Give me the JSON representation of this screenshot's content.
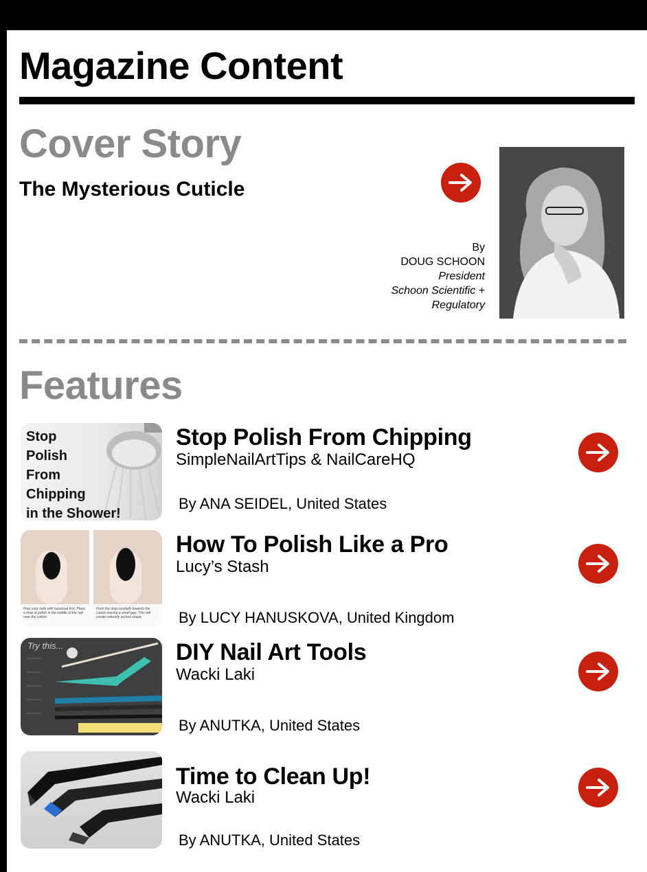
{
  "page": {
    "title": "Magazine Content"
  },
  "cover": {
    "heading": "Cover Story",
    "title": "The Mysterious Cuticle",
    "by_label": "By",
    "author": "DOUG SCHOON",
    "role": "President",
    "org_line1": "Schoon Scientific +",
    "org_line2": "Regulatory"
  },
  "features": {
    "heading": "Features",
    "items": [
      {
        "title": "Stop Polish From Chipping",
        "source": "SimpleNailArtTips & NailCareHQ",
        "author": "By ANA SEIDEL, United States",
        "thumb_lines": [
          "Stop",
          "Polish",
          "From",
          "Chipping",
          "in the Shower!"
        ]
      },
      {
        "title": "How To Polish Like a Pro",
        "source": "Lucy’s Stash",
        "author": "By LUCY HANUSKOVA, United Kingdom"
      },
      {
        "title": "DIY Nail Art Tools",
        "source": "Wacki Laki",
        "author": "By ANUTKA, United States",
        "thumb_label": "Try this..."
      },
      {
        "title": "Time to Clean Up!",
        "source": "Wacki Laki",
        "author": "By ANUTKA, United States"
      }
    ]
  },
  "colors": {
    "accent": "#c8200e",
    "heading_gray": "#8a8a8a",
    "rule": "#000000"
  },
  "icons": {
    "arrow": "arrow-right-circle-icon"
  }
}
